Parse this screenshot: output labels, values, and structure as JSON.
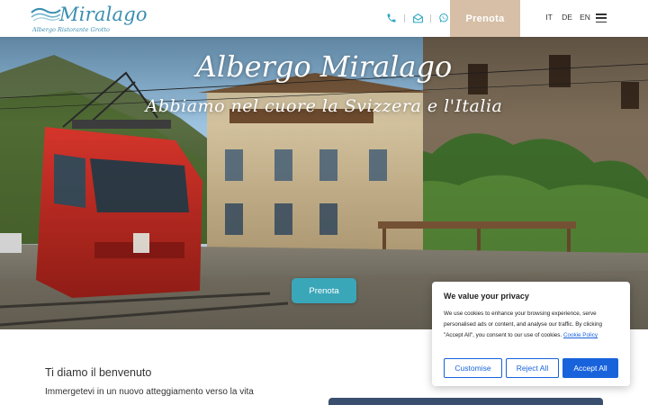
{
  "header": {
    "logo_title": "Miralago",
    "logo_subtitle": "Albergo Ristorante Grotto",
    "prenota_label": "Prenota",
    "languages": [
      "IT",
      "DE",
      "EN"
    ]
  },
  "hero": {
    "title": "Albergo Miralago",
    "subtitle": "Abbiamo nel cuore la Svizzera e l'Italia",
    "cta_label": "Prenota"
  },
  "welcome": {
    "title": "Ti diamo il benvenuto",
    "subtitle": "Immergetevi in un nuovo atteggiamento verso la vita"
  },
  "cookie": {
    "title": "We value your privacy",
    "text": "We use cookies to enhance your browsing experience, serve personalised ads or content, and analyse our traffic. By clicking \"Accept All\", you consent to our use of cookies.",
    "policy_link": "Cookie Policy",
    "customise_label": "Customise",
    "reject_label": "Reject All",
    "accept_label": "Accept All"
  },
  "colors": {
    "brand_blue": "#3b8fb0",
    "prenota_beige": "#d6bfa6",
    "hero_button": "#3aa7b9",
    "cookie_blue": "#1863dc"
  },
  "icons": [
    "phone-icon",
    "mail-icon",
    "whatsapp-icon",
    "menu-icon"
  ]
}
